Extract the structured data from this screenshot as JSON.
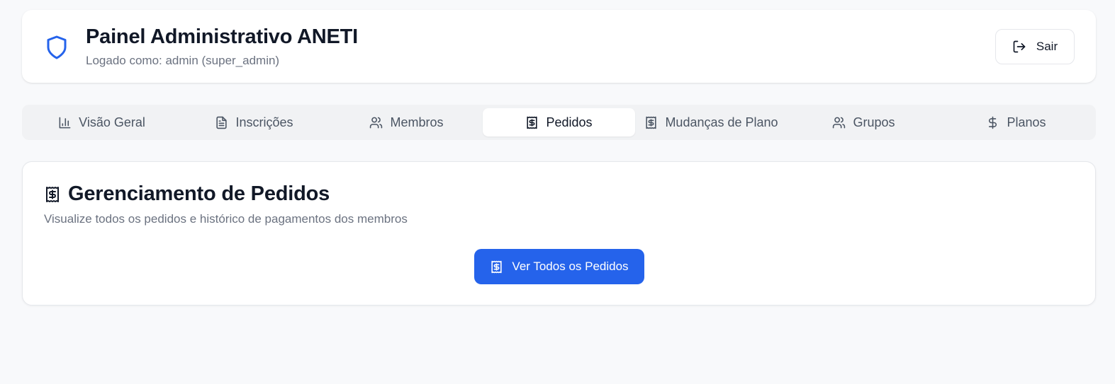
{
  "header": {
    "title": "Painel Administrativo ANETI",
    "subtitle": "Logado como: admin (super_admin)",
    "logout_label": "Sair",
    "accent_color": "#2563eb"
  },
  "tabs": [
    {
      "label": "Visão Geral",
      "icon": "bar-chart-icon",
      "active": false
    },
    {
      "label": "Inscrições",
      "icon": "file-text-icon",
      "active": false
    },
    {
      "label": "Membros",
      "icon": "users-icon",
      "active": false
    },
    {
      "label": "Pedidos",
      "icon": "receipt-icon",
      "active": true
    },
    {
      "label": "Mudanças de Plano",
      "icon": "receipt-icon",
      "active": false
    },
    {
      "label": "Grupos",
      "icon": "users-icon",
      "active": false
    },
    {
      "label": "Planos",
      "icon": "dollar-icon",
      "active": false
    }
  ],
  "main": {
    "title": "Gerenciamento de Pedidos",
    "description": "Visualize todos os pedidos e histórico de pagamentos dos membros",
    "button_label": "Ver Todos os Pedidos"
  }
}
